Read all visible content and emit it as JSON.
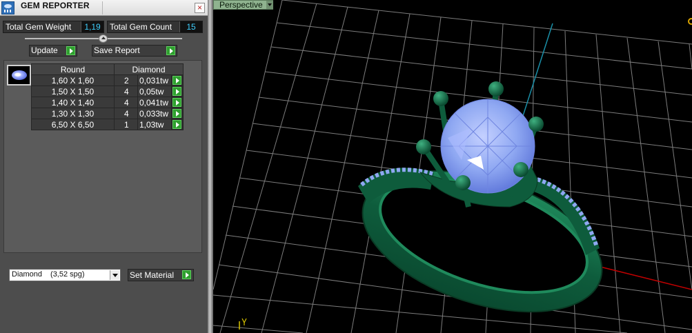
{
  "window": {
    "title": "GEM REPORTER",
    "close_glyph": "×"
  },
  "stats": {
    "total_weight_label": "Total Gem Weight",
    "total_weight_value": "1,19",
    "total_count_label": "Total Gem Count",
    "total_count_value": "15"
  },
  "buttons": {
    "update": "Update",
    "save_report": "Save Report",
    "set_material": "Set Material"
  },
  "gem_table": {
    "shape": "Round",
    "material": "Diamond",
    "rows": [
      {
        "size": "1,60 X 1,60",
        "count": "2",
        "weight": "0,031tw"
      },
      {
        "size": "1,50 X 1,50",
        "count": "4",
        "weight": "0,05tw"
      },
      {
        "size": "1,40 X 1,40",
        "count": "4",
        "weight": "0,041tw"
      },
      {
        "size": "1,30 X 1,30",
        "count": "4",
        "weight": "0,033tw"
      },
      {
        "size": "6,50 X 6,50",
        "count": "1",
        "weight": "1,03tw"
      }
    ]
  },
  "material_select": {
    "name": "Diamond",
    "density": "(3,52 spg)"
  },
  "viewport": {
    "view_mode": "Perspective"
  },
  "icons": {
    "app": "gem-reporter-app-icon",
    "close": "close-icon",
    "play": "play-icon",
    "gem_thumb": "round-gem-icon",
    "dropdown": "chevron-down-icon",
    "view_settings": "view-settings-icon"
  },
  "colors": {
    "panel_bg": "#4d4d4d",
    "value_text": "#3fd0ff",
    "play_green": "#2fa02f",
    "grid": "#7d7d7d",
    "axis_y": "#1a8fa8",
    "axis_x": "#c00000",
    "ring_metal": "#0e5c3c",
    "gem": "#8fa8f2",
    "perspective_tab": "#8fb38f"
  }
}
